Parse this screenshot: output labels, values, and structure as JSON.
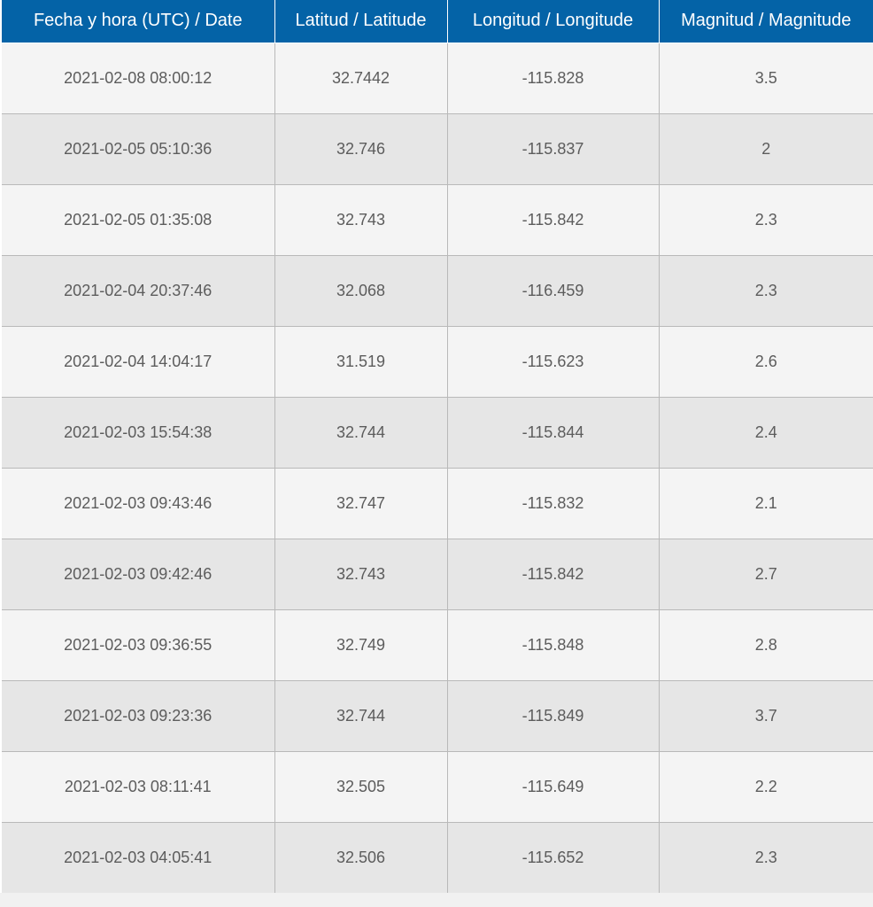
{
  "table": {
    "headers": {
      "date": "Fecha y hora (UTC) / Date",
      "latitude": "Latitud / Latitude",
      "longitude": "Longitud / Longitude",
      "magnitude": "Magnitud / Magnitude"
    },
    "rows": [
      {
        "date": "2021-02-08 08:00:12",
        "latitude": "32.7442",
        "longitude": "-115.828",
        "magnitude": "3.5"
      },
      {
        "date": "2021-02-05 05:10:36",
        "latitude": "32.746",
        "longitude": "-115.837",
        "magnitude": "2"
      },
      {
        "date": "2021-02-05 01:35:08",
        "latitude": "32.743",
        "longitude": "-115.842",
        "magnitude": "2.3"
      },
      {
        "date": "2021-02-04 20:37:46",
        "latitude": "32.068",
        "longitude": "-116.459",
        "magnitude": "2.3"
      },
      {
        "date": "2021-02-04 14:04:17",
        "latitude": "31.519",
        "longitude": "-115.623",
        "magnitude": "2.6"
      },
      {
        "date": "2021-02-03 15:54:38",
        "latitude": "32.744",
        "longitude": "-115.844",
        "magnitude": "2.4"
      },
      {
        "date": "2021-02-03 09:43:46",
        "latitude": "32.747",
        "longitude": "-115.832",
        "magnitude": "2.1"
      },
      {
        "date": "2021-02-03 09:42:46",
        "latitude": "32.743",
        "longitude": "-115.842",
        "magnitude": "2.7"
      },
      {
        "date": "2021-02-03 09:36:55",
        "latitude": "32.749",
        "longitude": "-115.848",
        "magnitude": "2.8"
      },
      {
        "date": "2021-02-03 09:23:36",
        "latitude": "32.744",
        "longitude": "-115.849",
        "magnitude": "3.7"
      },
      {
        "date": "2021-02-03 08:11:41",
        "latitude": "32.505",
        "longitude": "-115.649",
        "magnitude": "2.2"
      },
      {
        "date": "2021-02-03 04:05:41",
        "latitude": "32.506",
        "longitude": "-115.652",
        "magnitude": "2.3"
      }
    ]
  },
  "colors": {
    "header_background": "#0463a7",
    "header_text": "#ffffff",
    "row_light": "#f4f4f4",
    "row_dark": "#e6e6e6",
    "cell_text": "#5c5c5c",
    "grid_line": "#b9b9b9"
  }
}
